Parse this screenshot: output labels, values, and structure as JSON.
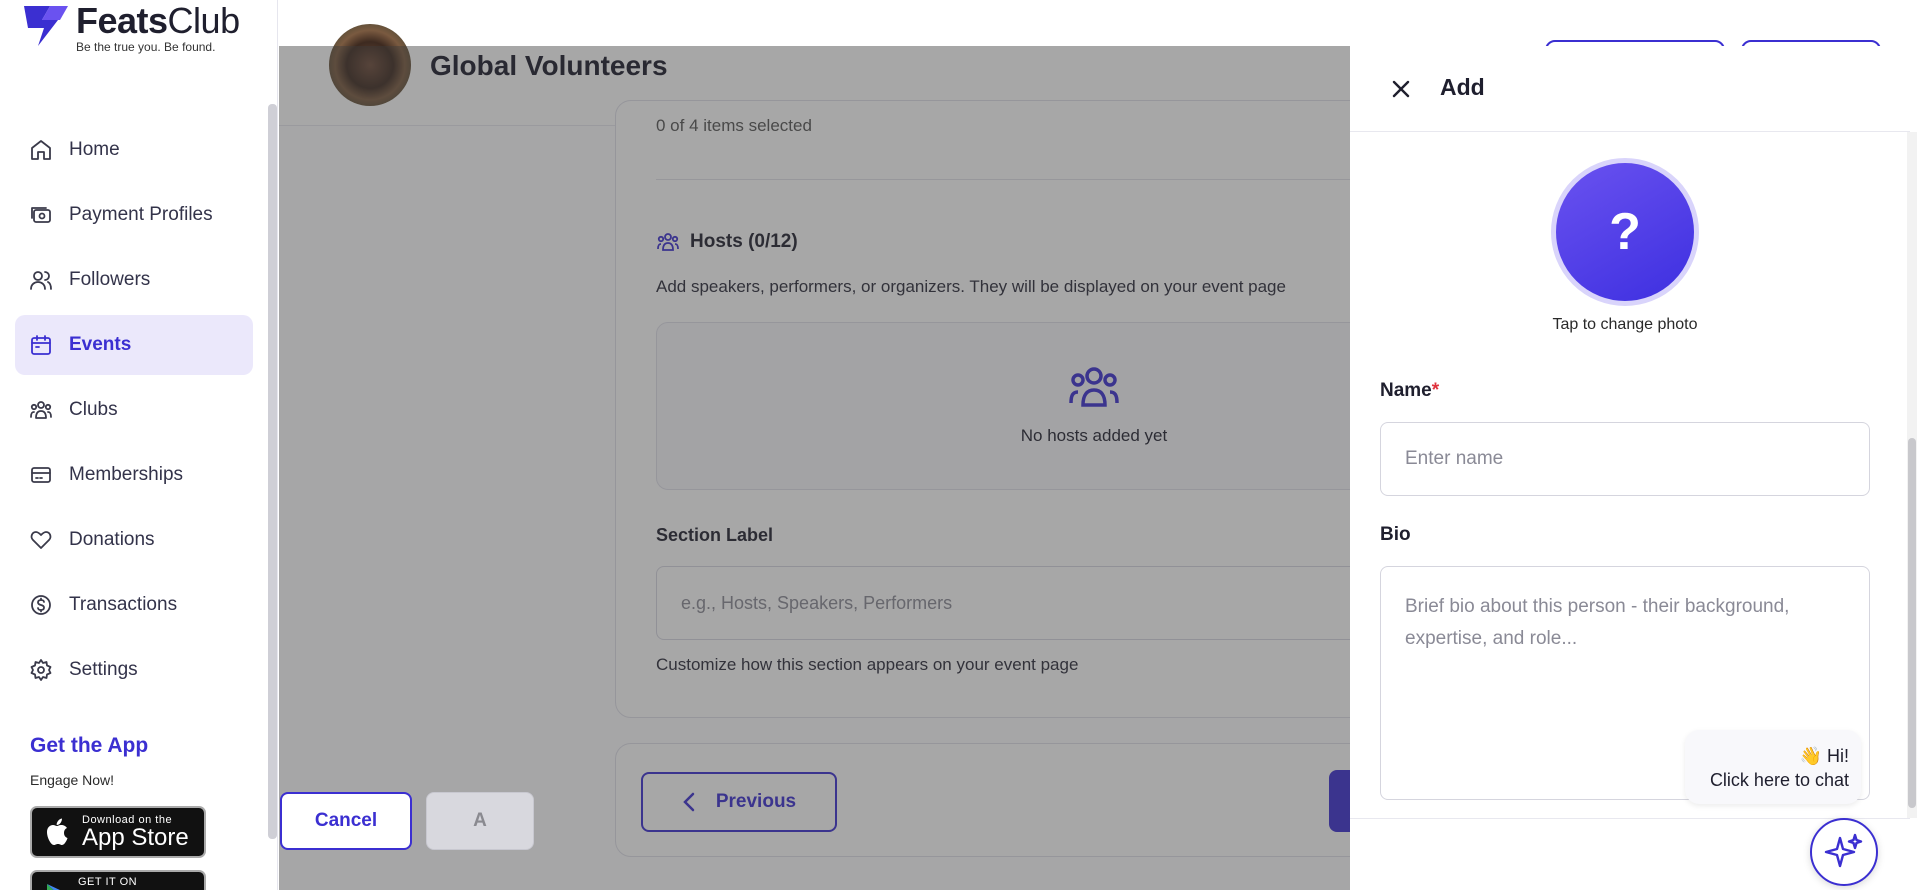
{
  "brand": {
    "name_bold": "Feats",
    "name_light": "Club",
    "tagline": "Be the true you. Be found."
  },
  "sidebar": {
    "items": [
      {
        "label": "Home",
        "icon": "home-icon"
      },
      {
        "label": "Payment Profiles",
        "icon": "payment-icon"
      },
      {
        "label": "Followers",
        "icon": "followers-icon"
      },
      {
        "label": "Events",
        "icon": "calendar-icon",
        "active": true
      },
      {
        "label": "Clubs",
        "icon": "clubs-icon"
      },
      {
        "label": "Memberships",
        "icon": "card-icon"
      },
      {
        "label": "Donations",
        "icon": "heart-icon"
      },
      {
        "label": "Transactions",
        "icon": "dollar-icon"
      },
      {
        "label": "Settings",
        "icon": "gear-icon"
      }
    ],
    "get_app": {
      "title": "Get the App",
      "subtitle": "Engage Now!"
    },
    "app_store": {
      "small": "Download on the",
      "big": "App Store"
    },
    "google_play": {
      "small": "GET IT ON"
    }
  },
  "header": {
    "org_name": "Global Volunteers"
  },
  "form": {
    "items_selected": "0 of 4 items selected",
    "hosts_title": "Hosts (0/12)",
    "hosts_description": "Add speakers, performers, or organizers. They will be displayed on your event page",
    "empty_text": "No hosts added yet",
    "section_label": "Section Label",
    "section_placeholder": "e.g., Hosts, Speakers, Performers",
    "section_hint": "Customize how this section appears on your event page",
    "previous_label": "Previous"
  },
  "drawer": {
    "title": "Add",
    "photo_glyph": "?",
    "photo_hint": "Tap to change photo",
    "name_label": "Name",
    "name_required": "*",
    "name_placeholder": "Enter name",
    "bio_label": "Bio",
    "bio_placeholder": "Brief bio about this person - their background, expertise, and role...",
    "cancel_label": "Cancel",
    "add_label": "A"
  },
  "chat": {
    "line1": "👋 Hi!",
    "line2": "Click here to chat"
  },
  "colors": {
    "accent": "#3b2fd1",
    "active_bg": "#ebe8fb",
    "required": "#e0323c"
  }
}
